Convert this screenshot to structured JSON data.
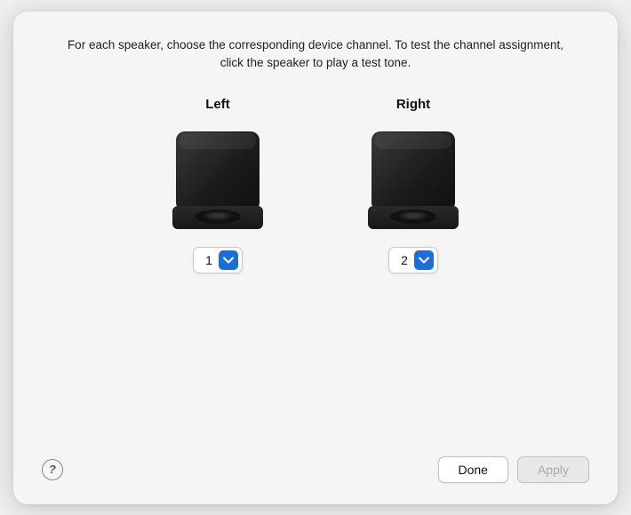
{
  "dialog": {
    "description": "For each speaker, choose the corresponding device channel. To test the channel assignment, click the speaker to play a test tone.",
    "speakers": [
      {
        "id": "left",
        "label": "Left",
        "channel": "1"
      },
      {
        "id": "right",
        "label": "Right",
        "channel": "2"
      }
    ],
    "footer": {
      "help_label": "?",
      "done_label": "Done",
      "apply_label": "Apply"
    }
  },
  "colors": {
    "accent": "#1a6ed8",
    "apply_disabled": "#aaa"
  }
}
